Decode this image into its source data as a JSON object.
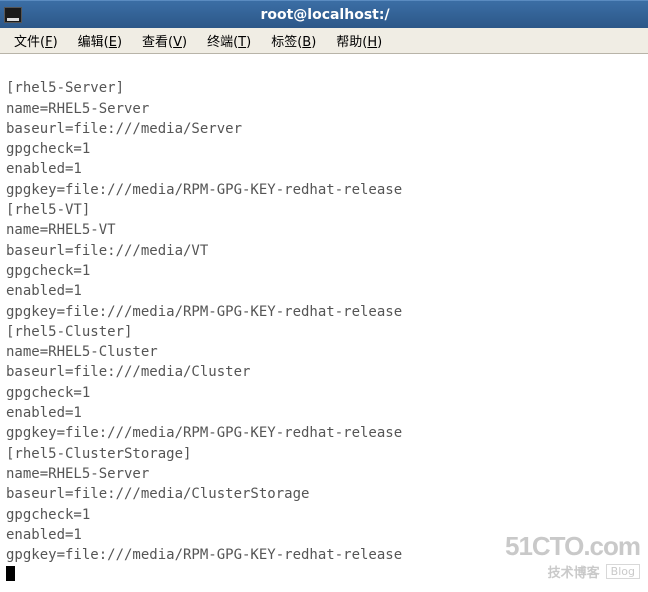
{
  "window": {
    "title": "root@localhost:/"
  },
  "menu": {
    "file": "文件(F)",
    "edit": "编辑(E)",
    "view": "查看(V)",
    "terminal": "终端(T)",
    "tabs": "标签(B)",
    "help": "帮助(H)"
  },
  "terminal": {
    "lines": [
      "[rhel5-Server]",
      "name=RHEL5-Server",
      "baseurl=file:///media/Server",
      "gpgcheck=1",
      "enabled=1",
      "gpgkey=file:///media/RPM-GPG-KEY-redhat-release",
      "[rhel5-VT]",
      "name=RHEL5-VT",
      "baseurl=file:///media/VT",
      "gpgcheck=1",
      "enabled=1",
      "gpgkey=file:///media/RPM-GPG-KEY-redhat-release",
      "[rhel5-Cluster]",
      "name=RHEL5-Cluster",
      "baseurl=file:///media/Cluster",
      "gpgcheck=1",
      "enabled=1",
      "gpgkey=file:///media/RPM-GPG-KEY-redhat-release",
      "[rhel5-ClusterStorage]",
      "name=RHEL5-Server",
      "baseurl=file:///media/ClusterStorage",
      "gpgcheck=1",
      "enabled=1",
      "gpgkey=file:///media/RPM-GPG-KEY-redhat-release"
    ]
  },
  "watermark": {
    "main": "51CTO.com",
    "cn": "技术博客",
    "blog": "Blog"
  }
}
